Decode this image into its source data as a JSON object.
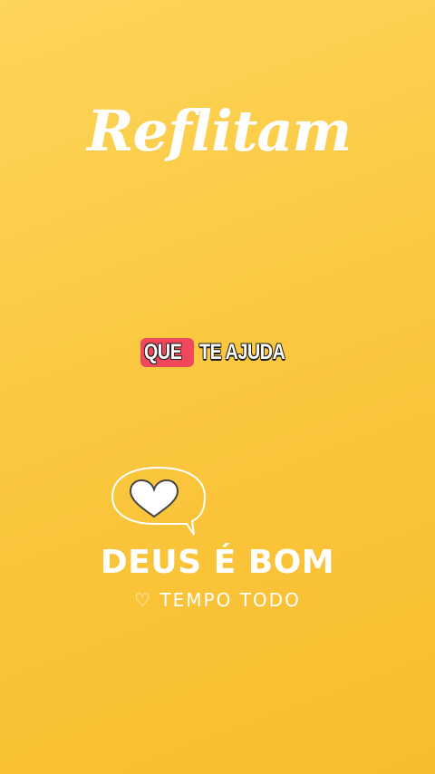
{
  "title": "Reflitam",
  "caption": {
    "highlighted_word": "QUE",
    "rest": "TE AJUDA"
  },
  "logo": {
    "icon": "heart-speech-bubble-icon",
    "line1": "DEUS É BOM",
    "line2": "♡ TEMPO TODO"
  },
  "colors": {
    "background": "#fbc840",
    "caption_highlight": "#f1475c",
    "text": "#ffffff"
  }
}
